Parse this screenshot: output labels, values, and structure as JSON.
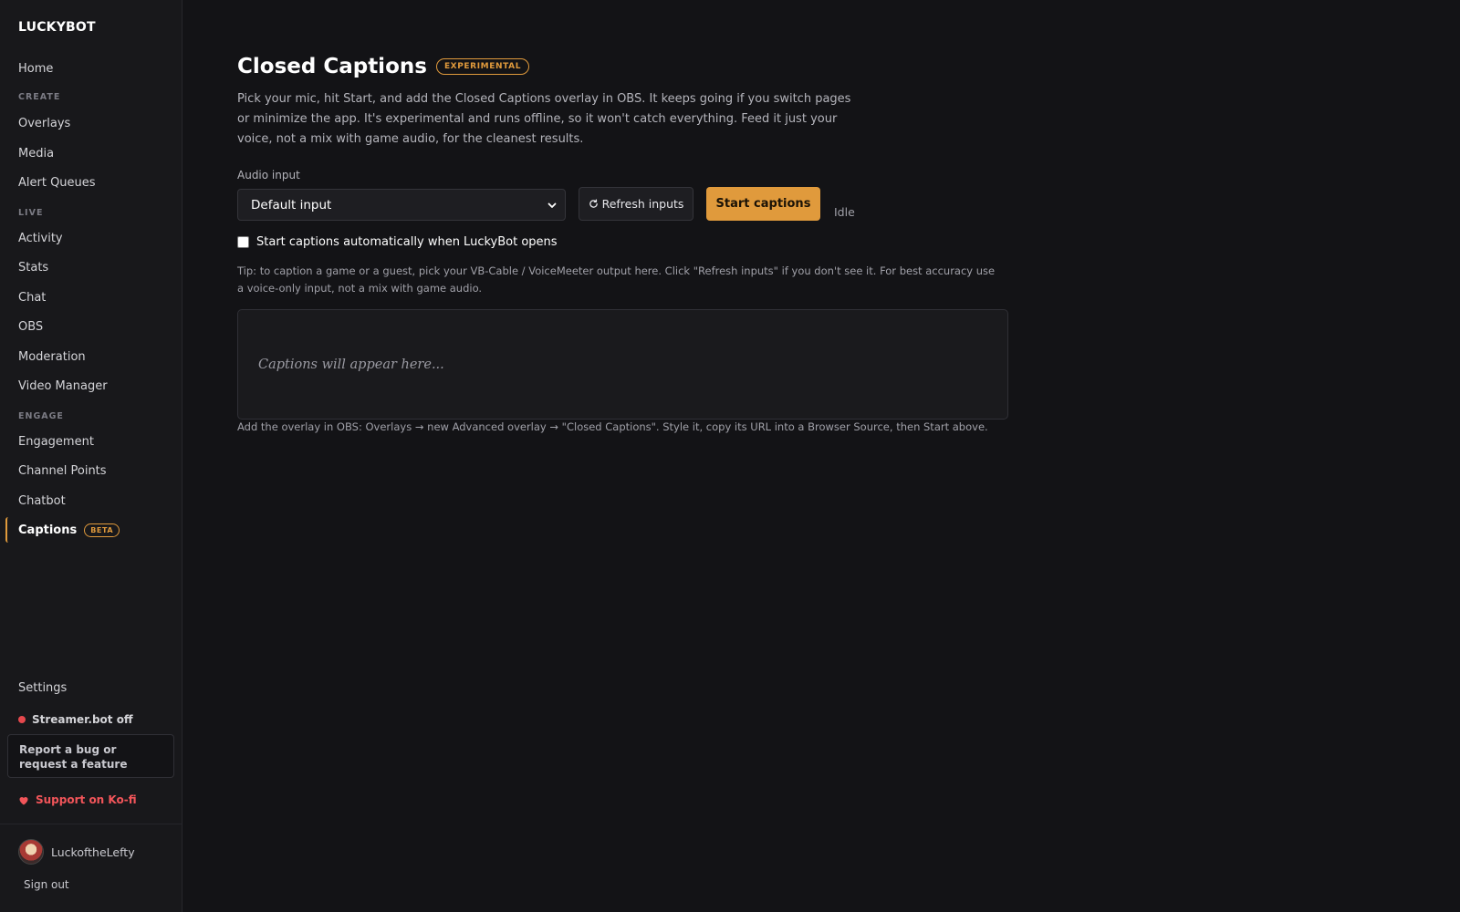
{
  "sidebar": {
    "brand": "LUCKYBOT",
    "home": "Home",
    "sections": {
      "create": "CREATE",
      "live": "LIVE",
      "engage": "ENGAGE"
    },
    "create_items": [
      "Overlays",
      "Media",
      "Alert Queues"
    ],
    "live_items": [
      "Activity",
      "Stats",
      "Chat",
      "OBS",
      "Moderation",
      "Video Manager"
    ],
    "engage_items": [
      "Engagement",
      "Channel Points",
      "Chatbot"
    ],
    "captions": {
      "label": "Captions",
      "badge": "BETA"
    },
    "settings": "Settings",
    "streamer_status": "Streamer.bot off",
    "report": "Report a bug or request a feature",
    "kofi": "Support on Ko-fi",
    "username": "LuckoftheLefty",
    "signout": "Sign out"
  },
  "main": {
    "title": "Closed Captions",
    "badge": "EXPERIMENTAL",
    "description": "Pick your mic, hit Start, and add the Closed Captions overlay in OBS. It keeps going if you switch pages or minimize the app. It's experimental and runs offline, so it won't catch everything. Feed it just your voice, not a mix with game audio, for the cleanest results.",
    "audio_label": "Audio input",
    "audio_selected": "Default input",
    "refresh_label": "Refresh inputs",
    "start_label": "Start captions",
    "status": "Idle",
    "auto_start_label": "Start captions automatically when LuckyBot opens",
    "tip": "Tip: to caption a game or a guest, pick your VB-Cable / VoiceMeeter output here. Click \"Refresh inputs\" if you don't see it. For best accuracy use a voice-only input, not a mix with game audio.",
    "caption_placeholder": "Captions will appear here...",
    "overlay_hint": "Add the overlay in OBS: Overlays → new Advanced overlay → \"Closed Captions\". Style it, copy its URL into a Browser Source, then Start above."
  },
  "colors": {
    "accent": "#e09a3c",
    "status_off": "#e5484d",
    "kofi": "#f2555a"
  }
}
